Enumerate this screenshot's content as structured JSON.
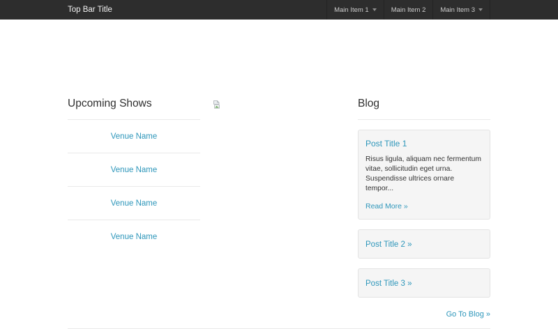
{
  "topbar": {
    "title": "Top Bar Title",
    "items": [
      {
        "label": "Main Item 1",
        "has_dropdown": true
      },
      {
        "label": "Main Item 2",
        "has_dropdown": false
      },
      {
        "label": "Main Item 3",
        "has_dropdown": true
      }
    ]
  },
  "shows": {
    "heading": "Upcoming Shows",
    "venues": [
      "Venue Name",
      "Venue Name",
      "Venue Name",
      "Venue Name"
    ]
  },
  "middle": {
    "image_state": "broken"
  },
  "blog": {
    "heading": "Blog",
    "posts": [
      {
        "title": "Post Title 1",
        "excerpt": "Risus ligula, aliquam nec fermentum vitae, sollicitudin eget urna. Suspendisse ultrices ornare tempor...",
        "read_more": "Read More »"
      },
      {
        "title": "Post Title 2 »"
      },
      {
        "title": "Post Title 3 »"
      }
    ],
    "go_to_blog": "Go To Blog »"
  },
  "colors": {
    "link": "#2d96ba",
    "navbar_bg": "#2d2d2d",
    "navbar_text": "#f2f2f2",
    "nav_item_text": "#cccccc",
    "card_bg": "#f5f5f5",
    "card_border": "#e3e3e3",
    "divider": "#e9e9e9",
    "heading_text": "#2e2e2e",
    "body_text": "#333333"
  }
}
